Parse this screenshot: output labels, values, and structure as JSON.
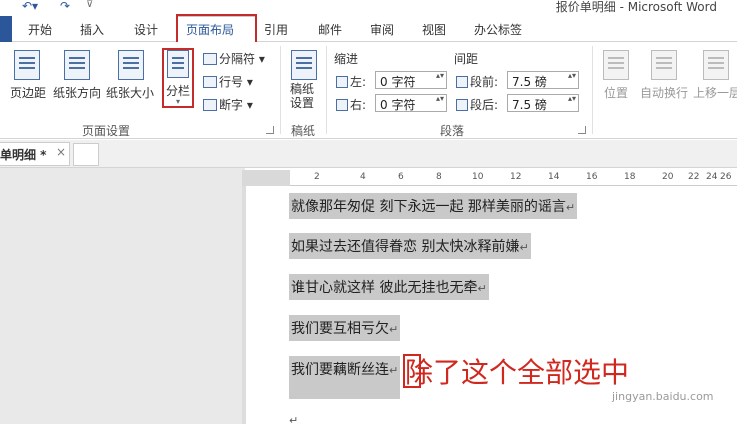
{
  "window": {
    "title": "报价单明细 - Microsoft Word"
  },
  "tabs": [
    "开始",
    "插入",
    "设计",
    "页面布局",
    "引用",
    "邮件",
    "审阅",
    "视图",
    "办公标签"
  ],
  "ribbon": {
    "page_setup": {
      "margins": "页边距",
      "orientation": "纸张方向",
      "size": "纸张大小",
      "columns": "分栏",
      "breaks": "分隔符",
      "line_numbers": "行号",
      "hyphenation": "断字",
      "group_label": "页面设置"
    },
    "draft": {
      "settings": "稿纸\n设置",
      "group_label": "稿纸"
    },
    "paragraph": {
      "indent_heading": "缩进",
      "spacing_heading": "间距",
      "left_label": "左:",
      "right_label": "右:",
      "left_value": "0 字符",
      "right_value": "0 字符",
      "before_label": "段前:",
      "after_label": "段后:",
      "before_value": "7.5 磅",
      "after_value": "7.5 磅",
      "group_label": "段落"
    },
    "arrange": {
      "position": "位置",
      "wrap": "自动换行",
      "bring_forward": "上移一层"
    }
  },
  "document_tab": {
    "label": "单明细 *",
    "close": "×"
  },
  "ruler": {
    "numbers": [
      "2",
      "2",
      "4",
      "6",
      "8",
      "10",
      "12",
      "14",
      "16",
      "18",
      "20",
      "22",
      "24",
      "26"
    ]
  },
  "document": {
    "lines": [
      "就像那年匆促 刻下永远一起 那样美丽的谣言",
      "如果过去还值得眷恋 别太快冰释前嫌",
      "谁甘心就这样 彼此无挂也无牵",
      "我们要互相亏欠",
      "我们要藕断丝连"
    ],
    "paragraph_mark": "↵"
  },
  "annotation": {
    "caption": "除了这个全部选中"
  },
  "watermark": "jingyan.baidu.com"
}
